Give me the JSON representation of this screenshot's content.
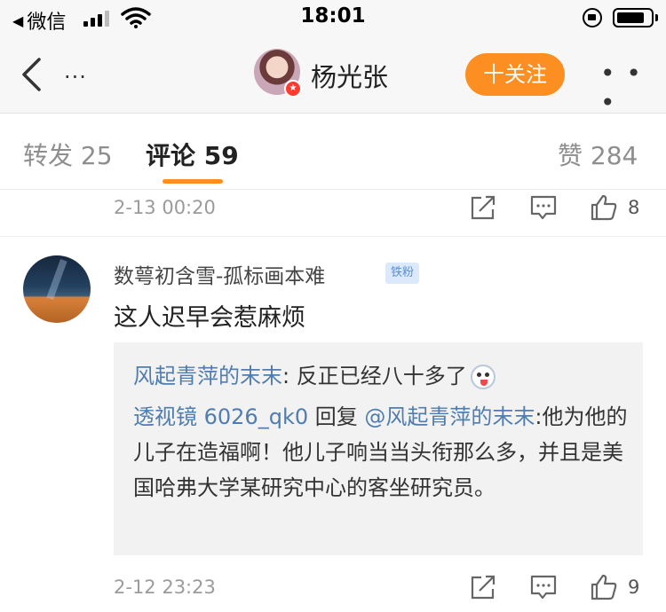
{
  "status_bar": {
    "back_label": "微信",
    "time": "18:01"
  },
  "nav": {
    "user_name": "杨光张",
    "follow_label": "十关注",
    "left_more": "...",
    "right_more": "• • •",
    "badge_icon": "v-verified-icon"
  },
  "tabs": {
    "repost": "转发 25",
    "comment": "评论 59",
    "like": "赞 284"
  },
  "previous_meta": {
    "time": "2-13 00:20",
    "like_count": "8"
  },
  "comment": {
    "author": "数萼初含雪-孤标画本难",
    "badge": "铁粉",
    "text": "这人迟早会惹麻烦",
    "replies": [
      {
        "author": "风起青萍的末末",
        "separator": ": ",
        "text": "反正已经八十多了",
        "emoji": "laughing-face-icon"
      },
      {
        "author": "透视镜 6026_qk0",
        "reply_word": " 回复 ",
        "mention": "@风起青萍的末末",
        "text": ":他为他的儿子在造福啊！他儿子响当当头衔那么多，并且是美国哈弗大学某研究中心的客坐研究员。"
      }
    ],
    "meta": {
      "time": "2-12 23:23",
      "like_count": "9"
    }
  },
  "colors": {
    "accent": "#fd8e22",
    "link": "#507daf",
    "reply_bg": "#f2f2f2",
    "badge_bg": "#dbe9fb"
  }
}
